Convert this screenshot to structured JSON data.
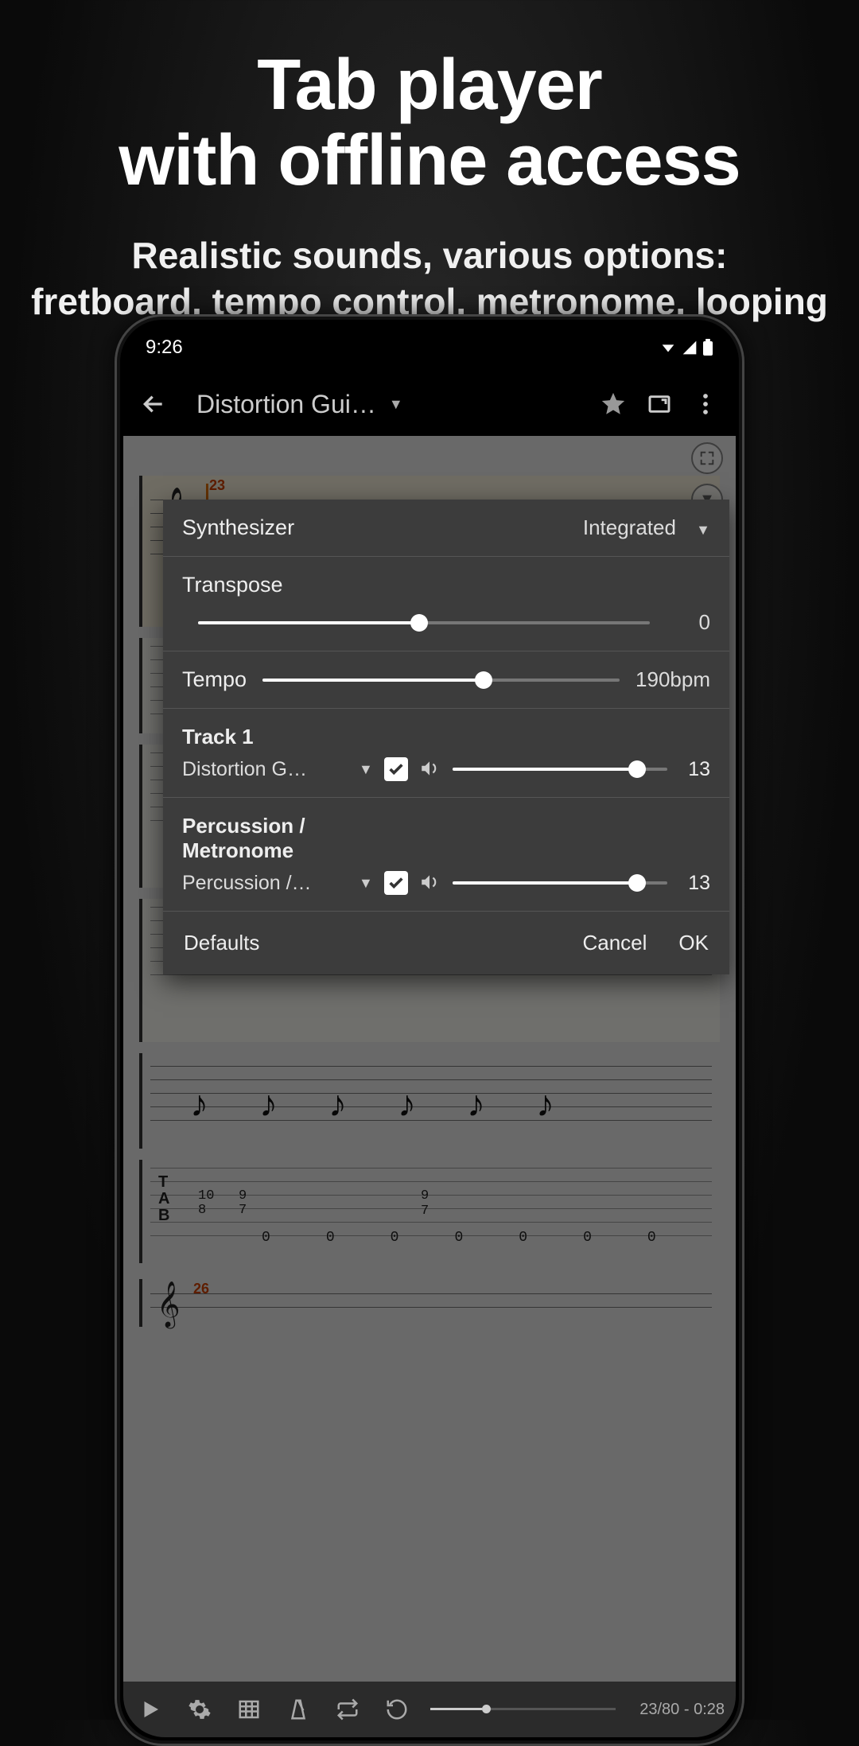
{
  "promo": {
    "title_line1": "Tab player",
    "title_line2": "with offline access",
    "subtitle_line1": "Realistic sounds, various options:",
    "subtitle_line2": "fretboard, tempo control, metronome, looping"
  },
  "status": {
    "time": "9:26"
  },
  "appbar": {
    "title": "Distortion Gui…"
  },
  "sheet": {
    "measure_highlight": "23",
    "measure_next": "26",
    "tab_label_T": "T",
    "tab_label_A": "A",
    "tab_label_B": "B",
    "tab_row1": [
      "10",
      "9"
    ],
    "tab_row1b": [
      "8",
      "7"
    ],
    "tab_cols": [
      "0",
      "0",
      "0",
      "0",
      "0",
      "0",
      "0"
    ],
    "tab_upper": [
      "9",
      "7"
    ]
  },
  "settings": {
    "synth_label": "Synthesizer",
    "synth_value": "Integrated",
    "transpose_label": "Transpose",
    "transpose_value": "0",
    "transpose_pct": 49,
    "tempo_label": "Tempo",
    "tempo_value": "190bpm",
    "tempo_pct": 62,
    "tracks": [
      {
        "title": "Track 1",
        "name": "Distortion G…",
        "checked": true,
        "volume_pct": 86,
        "volume_val": "13"
      },
      {
        "title": "Percussion / Metronome",
        "name": "Percussion /…",
        "checked": true,
        "volume_pct": 86,
        "volume_val": "13"
      }
    ],
    "defaults": "Defaults",
    "cancel": "Cancel",
    "ok": "OK"
  },
  "bottombar": {
    "counter": "23/80 - 0:28",
    "progress_pct": 28
  }
}
